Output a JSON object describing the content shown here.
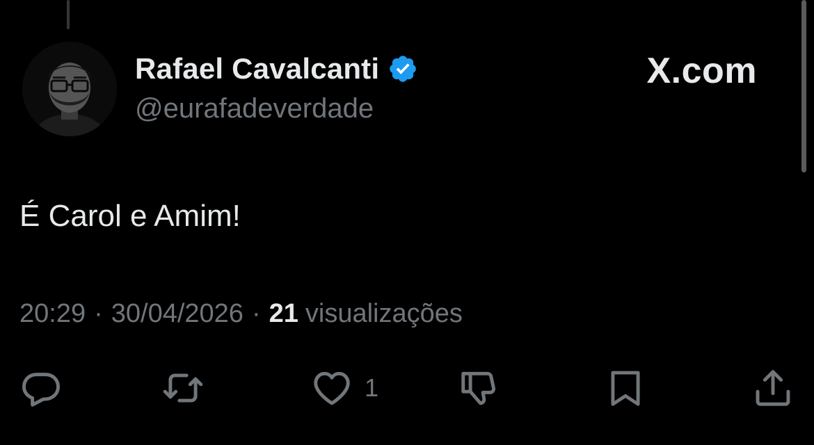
{
  "author": {
    "display_name": "Rafael Cavalcanti",
    "handle": "@eurafadeverdade",
    "verified": true,
    "verified_color": "#1d9bf0"
  },
  "brand": {
    "label": "X.com"
  },
  "tweet": {
    "text": "É Carol e Amim!",
    "time": "20:29",
    "separator": "·",
    "date": "30/04/2026",
    "views_count": "21",
    "views_label": "visualizações"
  },
  "actions": {
    "reply_icon": "speech-bubble-icon",
    "retweet_icon": "retweet-arrows-icon",
    "like_icon": "heart-icon",
    "like_count": "1",
    "dislike_icon": "thumbs-down-icon",
    "bookmark_icon": "bookmark-icon",
    "share_icon": "share-upload-icon"
  },
  "colors": {
    "background": "#000000",
    "text_primary": "#e7e9ea",
    "text_secondary": "#71767b"
  }
}
